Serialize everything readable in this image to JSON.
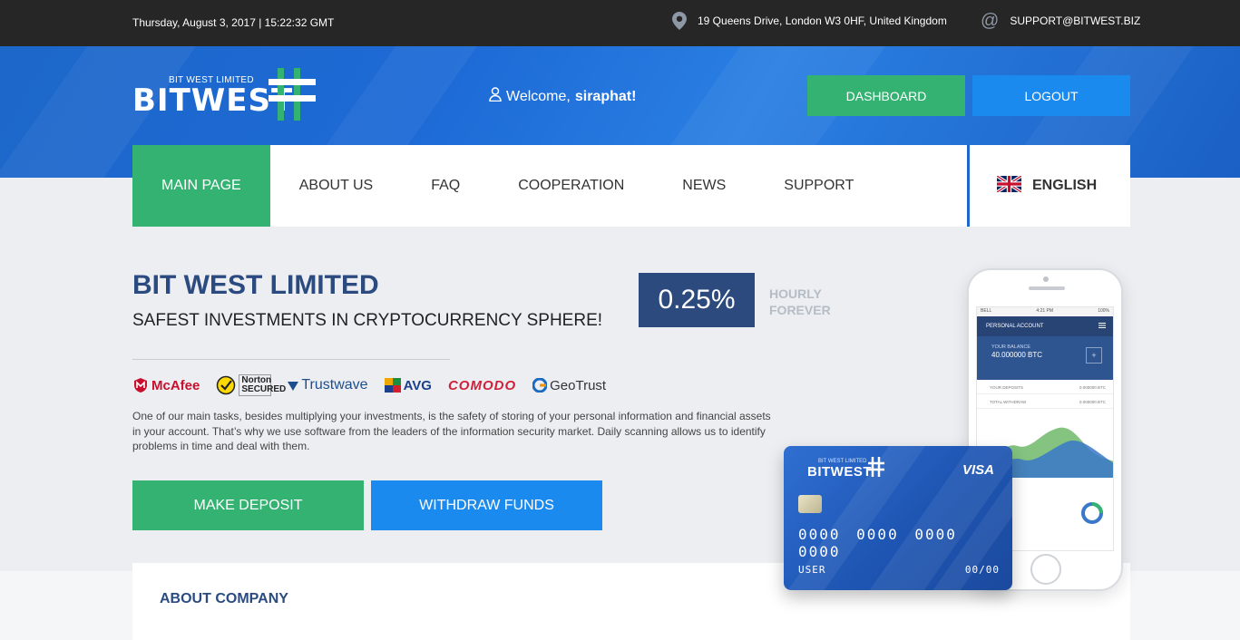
{
  "topbar": {
    "datetime": "Thursday, August 3, 2017 | 15:22:32 GMT",
    "address": "19 Queens Drive, London W3 0HF, United Kingdom",
    "email": "SUPPORT@BITWEST.BIZ"
  },
  "header": {
    "logo_small": "BIT WEST LIMITED",
    "logo_big": "BITWEST",
    "welcome_prefix": "Welcome,",
    "username": "siraphat!",
    "dashboard_label": "DASHBOARD",
    "logout_label": "LOGOUT"
  },
  "nav": {
    "items": [
      {
        "label": "MAIN PAGE"
      },
      {
        "label": "ABOUT US"
      },
      {
        "label": "FAQ"
      },
      {
        "label": "COOPERATION"
      },
      {
        "label": "NEWS"
      },
      {
        "label": "SUPPORT"
      }
    ],
    "language": "ENGLISH"
  },
  "hero": {
    "title": "BIT WEST LIMITED",
    "subtitle": "SAFEST INVESTMENTS IN CRYPTOCURRENCY SPHERE!",
    "rate": "0.25%",
    "rate_line1": "HOURLY",
    "rate_line2": "FOREVER",
    "logos": [
      "McAfee",
      "Norton SECURED",
      "Trustwave",
      "AVG",
      "COMODO",
      "GeoTrust"
    ],
    "text": "One of our main tasks, besides multiplying your investments, is the safety of storing of your personal information and financial assets in your account. That’s why we use software from the leaders of the information security market. Daily scanning allows us to identify problems in time and deal with them.",
    "deposit_label": "MAKE DEPOSIT",
    "withdraw_label": "WITHDRAW FUNDS"
  },
  "phone": {
    "status_left": "BELL",
    "status_time": "4:21 PM",
    "status_right": "100%",
    "account_label": "PERSONAL ACCOUNT",
    "balance_label": "YOUR BALANCE",
    "balance_value": "40.000000 BTC",
    "row1_label": "YOUR DEPOSITS",
    "row1_value": "0.000000 BTC",
    "row2_label": "TOTAL WITHDRAW",
    "row2_value": "0.000000 BTC"
  },
  "card": {
    "small": "BIT WEST LIMITED",
    "name": "BITWEST",
    "brand": "VISA",
    "number": "0000 0000 0000 0000",
    "holder": "USER",
    "expiry": "00/00"
  },
  "about": {
    "title": "ABOUT COMPANY"
  },
  "colors": {
    "green": "#33b271",
    "blue": "#1a8aee",
    "navy": "#2c4a7d",
    "topbar": "#262626"
  }
}
